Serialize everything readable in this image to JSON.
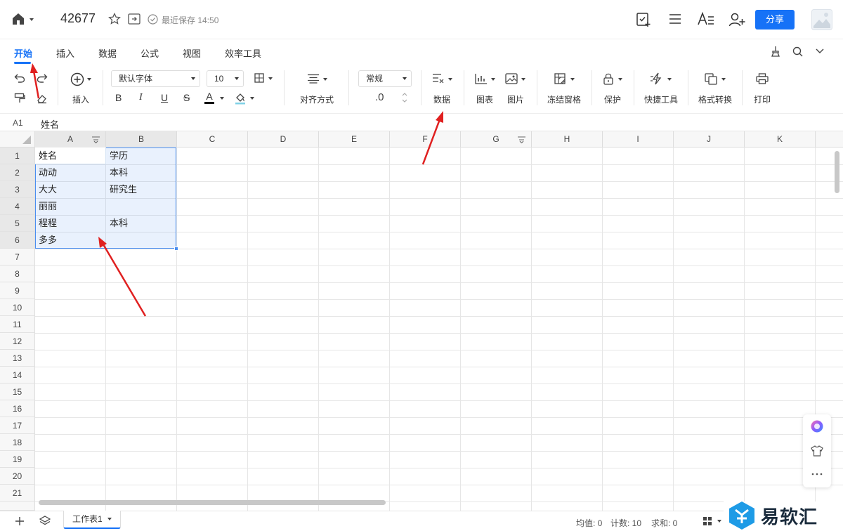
{
  "titlebar": {
    "doc_title": "42677",
    "save_status": "最近保存 14:50",
    "share_label": "分享"
  },
  "menu": {
    "tabs": [
      {
        "label": "开始",
        "active": true
      },
      {
        "label": "插入"
      },
      {
        "label": "数据"
      },
      {
        "label": "公式"
      },
      {
        "label": "视图"
      },
      {
        "label": "效率工具"
      }
    ]
  },
  "toolbar": {
    "insert_label": "插入",
    "font_name": "默认字体",
    "font_size": "10",
    "bold": "B",
    "italic": "I",
    "underline": "U",
    "strike": "S",
    "font_color_glyph": "A",
    "align_label": "对齐方式",
    "number_format": "常规",
    "decimal": ".0",
    "data_label": "数据",
    "chart_label": "图表",
    "image_label": "图片",
    "freeze_label": "冻结窗格",
    "protect_label": "保护",
    "quick_tools_label": "快捷工具",
    "format_convert_label": "格式转换",
    "print_label": "打印"
  },
  "formula_bar": {
    "cell_ref": "A1",
    "value": "姓名"
  },
  "grid": {
    "columns": [
      "A",
      "B",
      "C",
      "D",
      "E",
      "F",
      "G",
      "H",
      "I",
      "J",
      "K"
    ],
    "rows": [
      "1",
      "2",
      "3",
      "4",
      "5",
      "6",
      "7",
      "8",
      "9",
      "10",
      "11",
      "12",
      "13",
      "14",
      "15",
      "16",
      "17",
      "18",
      "19",
      "20",
      "21"
    ],
    "cells": [
      [
        "姓名",
        "学历"
      ],
      [
        "动动",
        "本科"
      ],
      [
        "大大",
        "研究生"
      ],
      [
        "丽丽",
        ""
      ],
      [
        "程程",
        "本科"
      ],
      [
        "多多",
        ""
      ]
    ]
  },
  "sheet": {
    "tab_label": "工作表1"
  },
  "status": {
    "average": "均值: 0",
    "count": "计数: 10",
    "sum": "求和: 0"
  },
  "watermark": {
    "text": "易软汇"
  },
  "colors": {
    "accent": "#1672f7",
    "selection": "#4a8ef0",
    "arrow": "#e02020"
  }
}
